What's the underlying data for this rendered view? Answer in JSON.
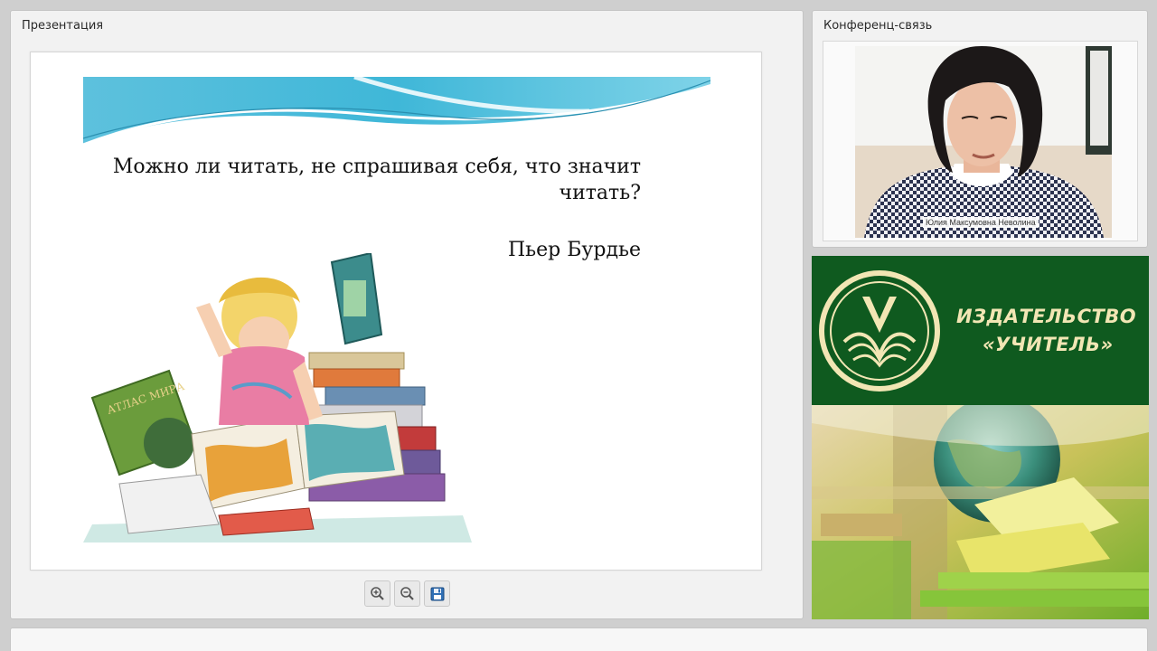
{
  "presentation": {
    "title": "Презентация",
    "slide": {
      "question": "Можно ли читать, не спрашивая себя, что значит читать?",
      "author": "Пьер Бурдье",
      "illustration_text": "АТЛАС МИРА"
    },
    "toolbar": {
      "zoom_in_icon": "magnifier-plus",
      "zoom_out_icon": "magnifier-minus",
      "save_icon": "floppy-disk"
    }
  },
  "conference": {
    "title": "Конференц-связь",
    "participant_name": "Юлия Максумовна Неволина"
  },
  "advert": {
    "line1": "ИЗДАТЕЛЬСТВО",
    "line2": "«УЧИТЕЛЬ»",
    "colors": {
      "green": "#0f5a1f",
      "gold": "#f2e6b4"
    }
  }
}
